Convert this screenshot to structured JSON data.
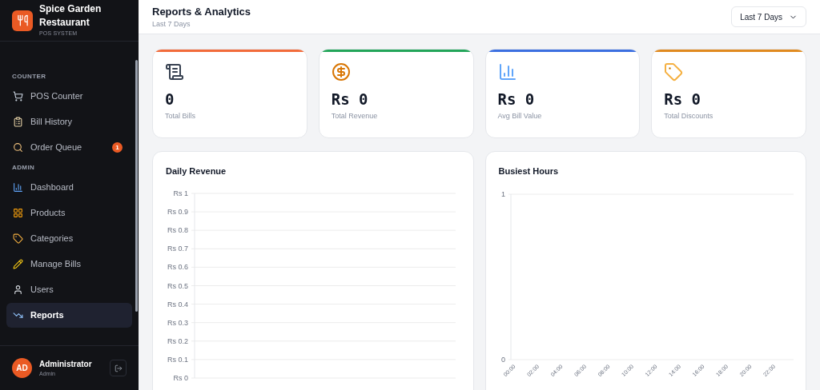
{
  "brand": {
    "name": "Spice Garden Restaurant",
    "subtitle": "POS SYSTEM"
  },
  "sidebar": {
    "sections": [
      {
        "title": "COUNTER",
        "items": [
          {
            "label": "POS Counter",
            "selected": false
          },
          {
            "label": "Bill History",
            "selected": false
          },
          {
            "label": "Order Queue",
            "selected": false,
            "badge": "1"
          }
        ]
      },
      {
        "title": "ADMIN",
        "items": [
          {
            "label": "Dashboard",
            "selected": false
          },
          {
            "label": "Products",
            "selected": false
          },
          {
            "label": "Categories",
            "selected": false
          },
          {
            "label": "Manage Bills",
            "selected": false
          },
          {
            "label": "Users",
            "selected": false
          },
          {
            "label": "Reports",
            "selected": true
          }
        ]
      }
    ]
  },
  "user": {
    "initials": "AD",
    "name": "Administrator",
    "role": "Admin"
  },
  "header": {
    "title": "Reports & Analytics",
    "subtitle": "Last 7 Days",
    "range_select": "Last 7 Days"
  },
  "stats": [
    {
      "value": "0",
      "label": "Total Bills",
      "color": "#f26b3a"
    },
    {
      "value": "Rs 0",
      "label": "Total Revenue",
      "color": "#22a559"
    },
    {
      "value": "Rs 0",
      "label": "Avg Bill Value",
      "color": "#3b6fe0"
    },
    {
      "value": "Rs 0",
      "label": "Total Discounts",
      "color": "#e08a1f"
    }
  ],
  "charts": [
    {
      "title": "Daily Revenue",
      "y_axis_labels": [
        "Rs 1",
        "Rs 0.9",
        "Rs 0.8",
        "Rs 0.7",
        "Rs 0.6",
        "Rs 0.5",
        "Rs 0.4",
        "Rs 0.3",
        "Rs 0.2",
        "Rs 0.1",
        "Rs 0"
      ]
    },
    {
      "title": "Busiest Hours",
      "chart_data": {
        "type": "bar",
        "values": [
          0,
          0,
          0,
          0,
          0,
          0,
          0,
          0,
          0,
          0,
          0,
          0
        ],
        "ylim": [
          0,
          1
        ],
        "yticks": [
          0,
          1
        ],
        "categories": [
          "00:00",
          "02:00",
          "04:00",
          "06:00",
          "08:00",
          "10:00",
          "12:00",
          "14:00",
          "16:00",
          "18:00",
          "20:00",
          "22:00"
        ]
      }
    }
  ]
}
